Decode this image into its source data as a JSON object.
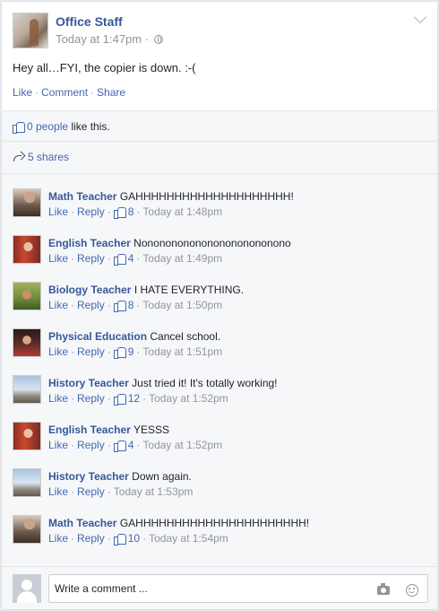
{
  "post": {
    "author": "Office Staff",
    "time": "Today at 1:47pm ·",
    "text": "Hey all…FYI, the copier is down. :-(",
    "actions": {
      "like": "Like",
      "comment": "Comment",
      "share": "Share"
    },
    "likes": {
      "count_text": "0 people",
      "suffix": " like this."
    },
    "shares": {
      "text": "5 shares"
    }
  },
  "comments": [
    {
      "author": "Math Teacher",
      "text": "GAHHHHHHHHHHHHHHHHHHHH!",
      "likes": "8",
      "time": "Today at 1:48pm"
    },
    {
      "author": "English Teacher",
      "text": "Nonononononononononononono",
      "likes": "4",
      "time": "Today at 1:49pm"
    },
    {
      "author": "Biology Teacher",
      "text": "I HATE EVERYTHING.",
      "likes": "8",
      "time": "Today at 1:50pm"
    },
    {
      "author": "Physical Education",
      "text": "Cancel school.",
      "likes": "9",
      "time": "Today at 1:51pm"
    },
    {
      "author": "History Teacher",
      "text": "Just tried it! It's totally working!",
      "likes": "12",
      "time": "Today at 1:52pm"
    },
    {
      "author": "English Teacher",
      "text": "YESSS",
      "likes": "4",
      "time": "Today at 1:52pm"
    },
    {
      "author": "History Teacher",
      "text": "Down again.",
      "likes": "",
      "time": "Today at 1:53pm"
    },
    {
      "author": "Math Teacher",
      "text": "GAHHHHHHHHHHHHHHHHHHHHHH!",
      "likes": "10",
      "time": "Today at 1:54pm"
    }
  ],
  "comment_actions": {
    "like": "Like",
    "reply": "Reply"
  },
  "write_comment": {
    "placeholder": "Write a comment ..."
  },
  "icons": [
    "chevron-down-icon",
    "globe-icon",
    "thumbs-up-icon",
    "share-arrow-icon",
    "camera-icon",
    "smiley-icon"
  ]
}
